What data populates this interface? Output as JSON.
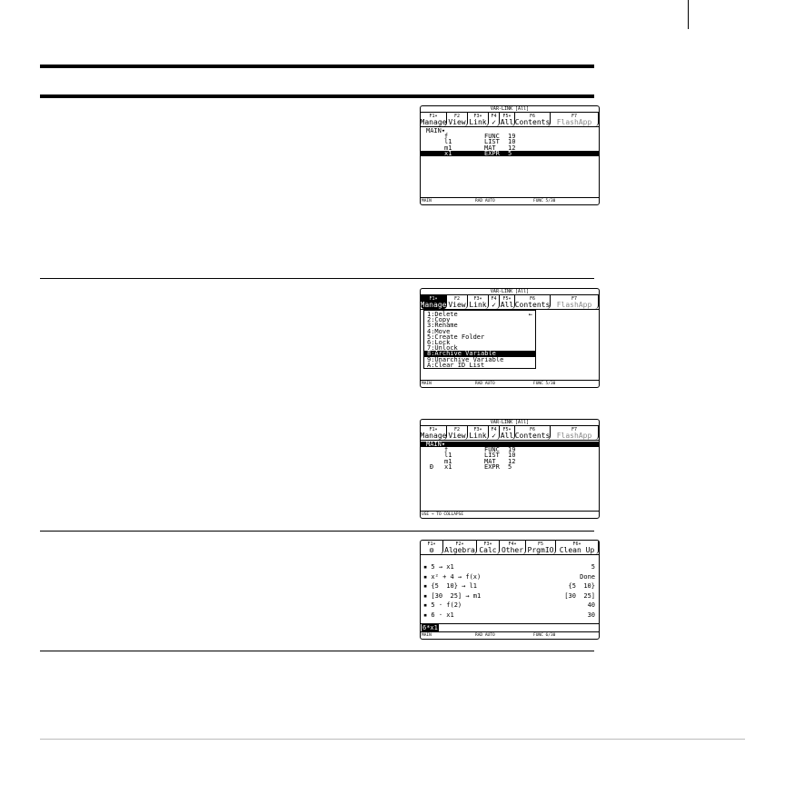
{
  "screen1": {
    "title": "VAR-LINK [All]",
    "tabs": [
      {
        "key": "F1▾",
        "label": "Manage"
      },
      {
        "key": "F2",
        "label": "View"
      },
      {
        "key": "F3▾",
        "label": "Link"
      },
      {
        "key": "F4",
        "label": "✓"
      },
      {
        "key": "F5▾",
        "label": "All"
      },
      {
        "key": "F6",
        "label": "Contents"
      },
      {
        "key": "F7",
        "label": "FlashApp"
      }
    ],
    "folder": "MAIN▾",
    "rows": [
      {
        "mark": "",
        "name": "f",
        "type": "FUNC",
        "size": "19"
      },
      {
        "mark": "",
        "name": "l1",
        "type": "LIST",
        "size": "10"
      },
      {
        "mark": "",
        "name": "m1",
        "type": "MAT",
        "size": "12"
      },
      {
        "mark": "",
        "name": "x1",
        "type": "EXPR",
        "size": "5"
      }
    ],
    "status": {
      "folder": "MAIN",
      "mode": "RAD AUTO",
      "graph": "FUNC 5/30"
    }
  },
  "screen2": {
    "title": "VAR-LINK [All]",
    "tabs": [
      {
        "key": "F1▾",
        "label": "Manage"
      },
      {
        "key": "F2",
        "label": "View"
      },
      {
        "key": "F3▾",
        "label": "Link"
      },
      {
        "key": "F4",
        "label": "✓"
      },
      {
        "key": "F5▾",
        "label": "All"
      },
      {
        "key": "F6",
        "label": "Contents"
      },
      {
        "key": "F7",
        "label": "FlashApp"
      }
    ],
    "menu": [
      "1:Delete",
      "2:Copy",
      "3:Rename",
      "4:Move",
      "5:Create Folder",
      "6:Lock",
      "7:Unlock",
      "8:Archive Variable",
      "9:Unarchive Variable",
      "A:Clear ID List"
    ],
    "status": {
      "folder": "MAIN",
      "mode": "RAD AUTO",
      "graph": "FUNC 5/30"
    }
  },
  "screen3": {
    "title": "VAR-LINK [All]",
    "tabs": [
      {
        "key": "F1▾",
        "label": "Manage"
      },
      {
        "key": "F2",
        "label": "View"
      },
      {
        "key": "F3▾",
        "label": "Link"
      },
      {
        "key": "F4",
        "label": "✓"
      },
      {
        "key": "F5▾",
        "label": "All"
      },
      {
        "key": "F6",
        "label": "Contents"
      },
      {
        "key": "F7",
        "label": "FlashApp"
      }
    ],
    "folder": "MAIN▾",
    "rows": [
      {
        "mark": "",
        "name": "f",
        "type": "FUNC",
        "size": "19"
      },
      {
        "mark": "",
        "name": "l1",
        "type": "LIST",
        "size": "10"
      },
      {
        "mark": "",
        "name": "m1",
        "type": "MAT",
        "size": "12"
      },
      {
        "mark": "Ð",
        "name": "x1",
        "type": "EXPR",
        "size": "5"
      }
    ],
    "status": {
      "hint": "USE → TO COLLAPSE"
    }
  },
  "screen4": {
    "tabs": [
      {
        "key": "F1▾",
        "label": "⚙"
      },
      {
        "key": "F2▾",
        "label": "Algebra"
      },
      {
        "key": "F3▾",
        "label": "Calc"
      },
      {
        "key": "F4▾",
        "label": "Other"
      },
      {
        "key": "F5",
        "label": "PrgmIO"
      },
      {
        "key": "F6▾",
        "label": "Clean Up"
      }
    ],
    "history": [
      {
        "expr": "▪ 5 → x1",
        "result": "5"
      },
      {
        "expr": "▪ x² + 4 → f(x)",
        "result": "Done"
      },
      {
        "expr": "▪ {5  10} → l1",
        "result": "{5  10}"
      },
      {
        "expr": "▪ [30  25] → m1",
        "result": "[30  25]"
      },
      {
        "expr": "▪ 5 · f(2)",
        "result": "40"
      },
      {
        "expr": "▪ 6 · x1",
        "result": "30"
      }
    ],
    "entry": "6*x1",
    "status": {
      "folder": "MAIN",
      "mode": "RAD AUTO",
      "graph": "FUNC 6/30"
    }
  }
}
